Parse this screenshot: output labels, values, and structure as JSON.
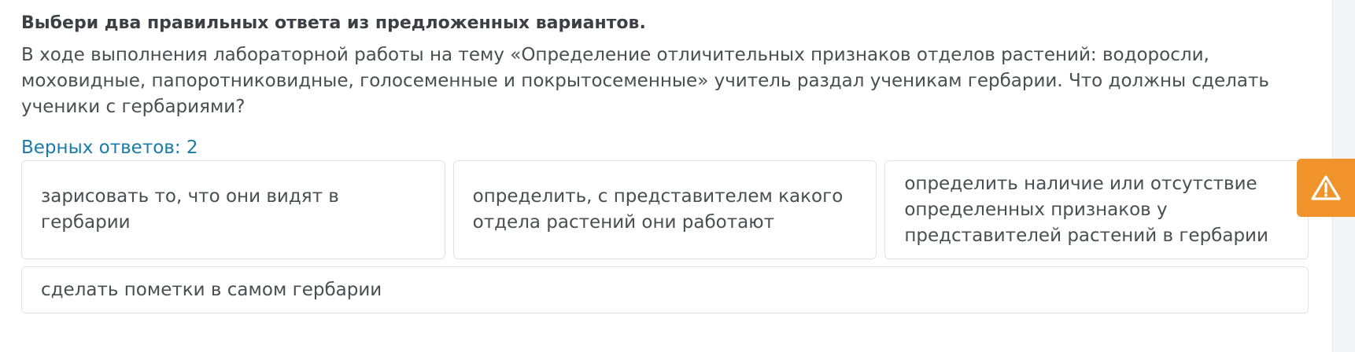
{
  "task": {
    "instruction": "Выбери два правильных ответа из предложенных вариантов.",
    "question": "В ходе выполнения лабораторной работы на тему «Определение отличительных признаков отделов растений: водоросли, моховидные, папоротниковидные, голосеменные и покрытосеменные» учитель раздал ученикам гербарии. Что должны сделать ученики с гербариями?",
    "correct_count_label": "Верных ответов: 2"
  },
  "options": [
    {
      "label": "зарисовать то, что они видят в гербарии"
    },
    {
      "label": "определить, с представителем какого отдела растений они работают"
    },
    {
      "label": "определить наличие или отсутствие определенных признаков у представителей растений в гербарии"
    },
    {
      "label": "сделать пометки в самом гербарии"
    }
  ],
  "report_button": {
    "icon": "warning-icon",
    "color": "#f0932b"
  }
}
